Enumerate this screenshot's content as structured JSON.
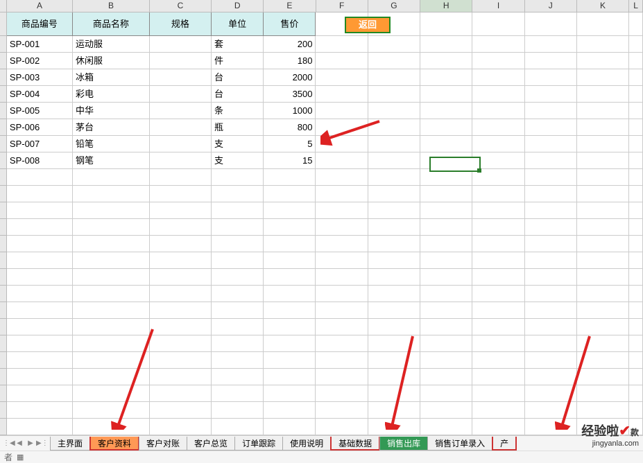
{
  "columns": [
    "A",
    "B",
    "C",
    "D",
    "E",
    "F",
    "G",
    "H",
    "I",
    "J",
    "K",
    "L"
  ],
  "headers": {
    "a": "商品编号",
    "b": "商品名称",
    "c": "规格",
    "d": "单位",
    "e": "售价"
  },
  "back_button": "返回",
  "rows": [
    {
      "code": "SP-001",
      "name": "运动服",
      "spec": "",
      "unit": "套",
      "price": "200"
    },
    {
      "code": "SP-002",
      "name": "休闲服",
      "spec": "",
      "unit": "件",
      "price": "180"
    },
    {
      "code": "SP-003",
      "name": "冰箱",
      "spec": "",
      "unit": "台",
      "price": "2000"
    },
    {
      "code": "SP-004",
      "name": "彩电",
      "spec": "",
      "unit": "台",
      "price": "3500"
    },
    {
      "code": "SP-005",
      "name": "中华",
      "spec": "",
      "unit": "条",
      "price": "1000"
    },
    {
      "code": "SP-006",
      "name": "茅台",
      "spec": "",
      "unit": "瓶",
      "price": "800"
    },
    {
      "code": "SP-007",
      "name": "铅笔",
      "spec": "",
      "unit": "支",
      "price": "5"
    },
    {
      "code": "SP-008",
      "name": "钢笔",
      "spec": "",
      "unit": "支",
      "price": "15"
    }
  ],
  "selected_col": "H",
  "tabs": [
    {
      "label": "主界面",
      "cls": ""
    },
    {
      "label": "客户资料",
      "cls": "active"
    },
    {
      "label": "客户对账",
      "cls": ""
    },
    {
      "label": "客户总览",
      "cls": ""
    },
    {
      "label": "订单跟踪",
      "cls": ""
    },
    {
      "label": "使用说明",
      "cls": ""
    },
    {
      "label": "基础数据",
      "cls": "highlight-red"
    },
    {
      "label": "销售出库",
      "cls": "green"
    },
    {
      "label": "销售订单录入",
      "cls": ""
    },
    {
      "label": "产",
      "cls": "highlight-red"
    }
  ],
  "status": {
    "author": "者"
  },
  "watermark": {
    "top": "经验啦",
    "bottom": "jingyanla.com",
    "cn": "款"
  }
}
